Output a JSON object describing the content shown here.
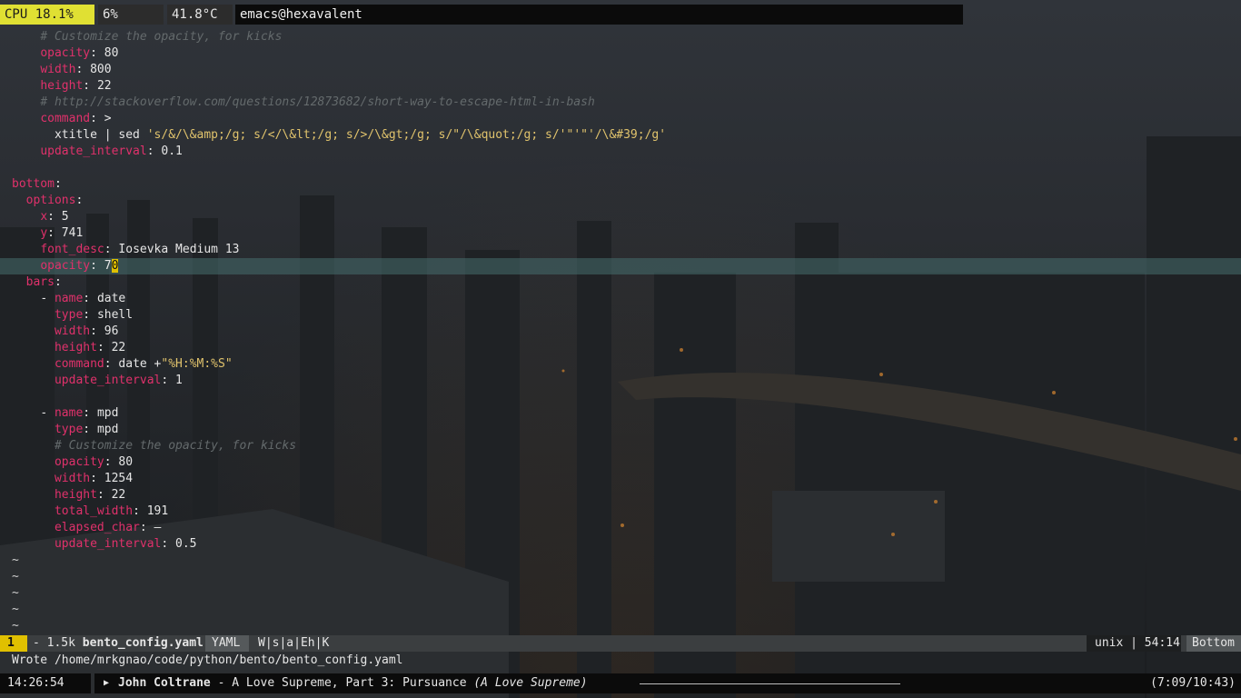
{
  "topbar": {
    "cpu": "CPU 18.1%",
    "mem": "6%",
    "temp": "41.8°C",
    "window_title": "emacs@hexavalent"
  },
  "editor": {
    "lines": [
      {
        "indent": "    ",
        "c": "# Customize the opacity, for kicks"
      },
      {
        "indent": "    ",
        "k": "opacity",
        "v": "80"
      },
      {
        "indent": "    ",
        "k": "width",
        "v": "800"
      },
      {
        "indent": "    ",
        "k": "height",
        "v": "22"
      },
      {
        "indent": "    ",
        "c": "# http://stackoverflow.com/questions/12873682/short-way-to-escape-html-in-bash"
      },
      {
        "indent": "    ",
        "k": "command",
        "v": ">"
      },
      {
        "indent": "      ",
        "t": "xtitle | sed ",
        "s": "'s/&/\\&amp;/g; s/</\\&lt;/g; s/>/\\&gt;/g; s/\"/\\&quot;/g; s/'\"'\"'/\\&#39;/g'"
      },
      {
        "indent": "    ",
        "k": "update_interval",
        "v": "0.1"
      },
      {
        "indent": ""
      },
      {
        "indent": "",
        "k": "bottom",
        "v": ""
      },
      {
        "indent": "  ",
        "k": "options",
        "v": ""
      },
      {
        "indent": "    ",
        "k": "x",
        "v": "5"
      },
      {
        "indent": "    ",
        "k": "y",
        "v": "741"
      },
      {
        "indent": "    ",
        "k": "font_desc",
        "v": "Iosevka Medium 13"
      },
      {
        "indent": "    ",
        "k": "opacity",
        "v": "7",
        "cursor": "0",
        "current": true
      },
      {
        "indent": "  ",
        "k": "bars",
        "v": ""
      },
      {
        "indent": "    - ",
        "k": "name",
        "v": "date"
      },
      {
        "indent": "      ",
        "k": "type",
        "v": "shell"
      },
      {
        "indent": "      ",
        "k": "width",
        "v": "96"
      },
      {
        "indent": "      ",
        "k": "height",
        "v": "22"
      },
      {
        "indent": "      ",
        "k": "command",
        "v": "date +",
        "s": "\"%H:%M:%S\""
      },
      {
        "indent": "      ",
        "k": "update_interval",
        "v": "1"
      },
      {
        "indent": ""
      },
      {
        "indent": "    - ",
        "k": "name",
        "v": "mpd"
      },
      {
        "indent": "      ",
        "k": "type",
        "v": "mpd"
      },
      {
        "indent": "      ",
        "c": "# Customize the opacity, for kicks"
      },
      {
        "indent": "      ",
        "k": "opacity",
        "v": "80"
      },
      {
        "indent": "      ",
        "k": "width",
        "v": "1254"
      },
      {
        "indent": "      ",
        "k": "height",
        "v": "22"
      },
      {
        "indent": "      ",
        "k": "total_width",
        "v": "191"
      },
      {
        "indent": "      ",
        "k": "elapsed_char",
        "v": "—"
      },
      {
        "indent": "      ",
        "k": "update_interval",
        "v": "0.5"
      },
      {
        "tilde": "~"
      },
      {
        "tilde": "~"
      },
      {
        "tilde": "~"
      },
      {
        "tilde": "~"
      },
      {
        "tilde": "~"
      }
    ]
  },
  "modeline": {
    "window_number": "1",
    "size_prefix": "- 1.5k ",
    "filename": "bento_config.yaml",
    "major_mode": "YAML",
    "minor_modes": "W|s|a|Eh|K",
    "encoding_pos": "unix | 54:14",
    "position": "Bottom"
  },
  "echo_area": "Wrote /home/mrkgnao/code/python/bento/bento_config.yaml",
  "bottombar": {
    "clock": "14:26:54",
    "play_icon": "play-icon",
    "artist": "John Coltrane",
    "track_sep": " - ",
    "track": "A Love Supreme, Part 3: Pursuance",
    "album": "(A Love Supreme)",
    "elapsed": "(7:09/10:43)",
    "progress": 0.667
  }
}
